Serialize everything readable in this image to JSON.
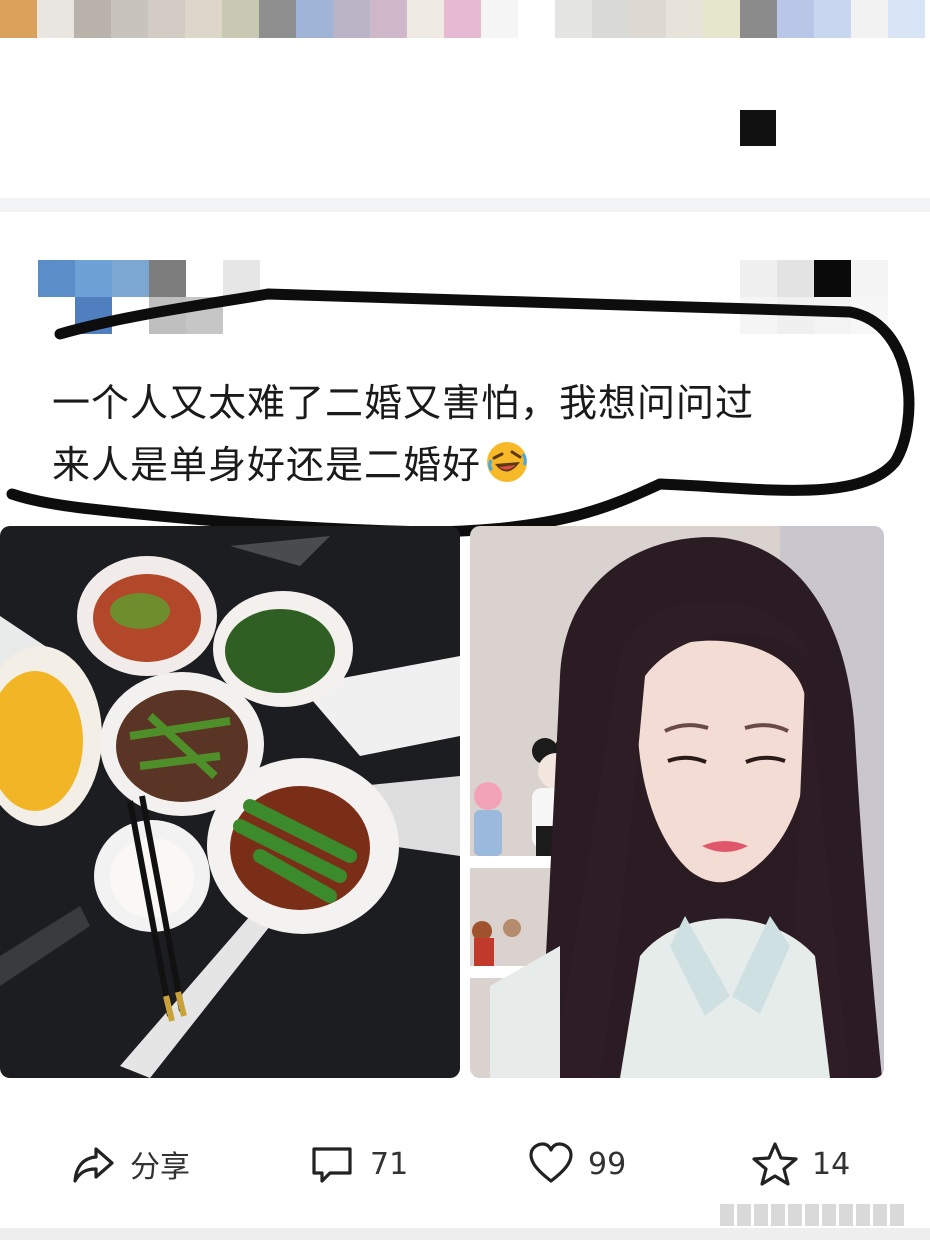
{
  "post": {
    "text_line1": "一个人又太难了二婚又害怕，我想问问过",
    "text_line2": "来人是单身好还是二婚好",
    "emoji": "rolling-on-floor-laughing-emoji",
    "images": [
      {
        "name": "food-photo",
        "alt": "dishes on a marble table"
      },
      {
        "name": "selfie-photo",
        "alt": "woman with long dark hair"
      }
    ]
  },
  "actions": {
    "share_label": "分享",
    "comment_count": "71",
    "like_count": "99",
    "favorite_count": "14"
  },
  "icons": [
    "share-icon",
    "comment-icon",
    "heart-icon",
    "star-icon"
  ],
  "colors": {
    "text": "#1a1a1a",
    "divider": "#f2f3f5",
    "marker": "#0d0d0d",
    "emoji_face": "#f7b928"
  }
}
